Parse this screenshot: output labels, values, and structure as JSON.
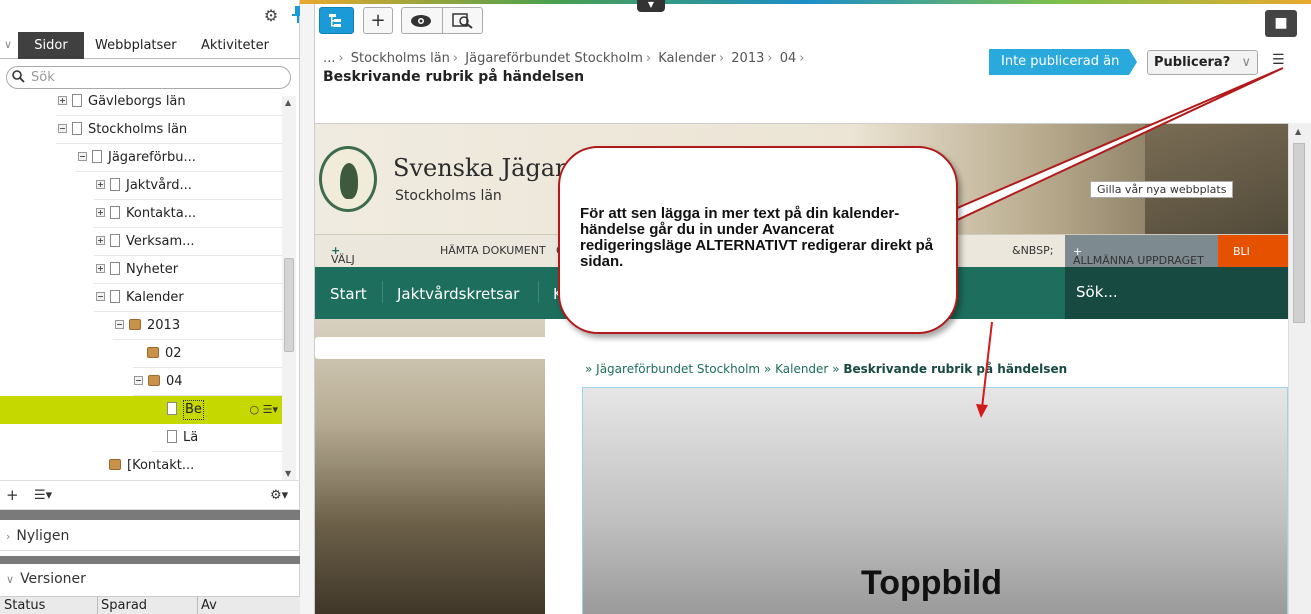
{
  "left_panel": {
    "tabs": [
      {
        "label": "Sidor",
        "active": true
      },
      {
        "label": "Webbplatser",
        "active": false
      },
      {
        "label": "Aktiviteter",
        "active": false
      }
    ],
    "search_placeholder": "Sök",
    "tree": [
      {
        "label": "Gävleborgs län"
      },
      {
        "label": "Stockholms län"
      },
      {
        "label": "Jägareförbu..."
      },
      {
        "label": "Jaktvård..."
      },
      {
        "label": "Kontakta..."
      },
      {
        "label": "Verksam..."
      },
      {
        "label": "Nyheter"
      },
      {
        "label": "Kalender"
      },
      {
        "label": "2013"
      },
      {
        "label": "02"
      },
      {
        "label": "04"
      },
      {
        "label": "Be"
      },
      {
        "label": "Lä"
      },
      {
        "label": "[Kontakt..."
      }
    ],
    "sections": {
      "recent": "Nyligen",
      "versions": "Versioner"
    },
    "versions_columns": [
      "Status",
      "Sparad",
      "Av"
    ]
  },
  "header": {
    "breadcrumb": [
      "...",
      "Stockholms län",
      "Jägareförbundet Stockholm",
      "Kalender",
      "2013",
      "04"
    ],
    "page_title": "Beskrivande rubrik på händelsen",
    "status": "Inte publicerad än",
    "publish_button": "Publicera?"
  },
  "site": {
    "name": "Svenska Jägaref",
    "subtitle": "Stockholms län",
    "like_tag": "Gilla vår nya webbplats",
    "topnav": {
      "items": [
        "VÄLJ DITT LÄN",
        "HÄMTA DOKUMENT",
        "C"
      ],
      "nbsp": "&NBSP;",
      "blue": "ALLMÄNNA UPPDRAGET",
      "orange": "BLI MEDLE"
    },
    "mainnav": {
      "items": [
        "Start",
        "Jaktvårdskretsar",
        "K"
      ],
      "search": "Sök..."
    },
    "content_breadcrumb": {
      "prefix1": "» ",
      "link1": "Jägareförbundet Stockholm",
      "prefix2": " » ",
      "link2": "Kalender",
      "prefix3": " » ",
      "current": "Beskrivande rubrik på händelsen"
    },
    "hero_label": "Toppbild"
  },
  "callout": {
    "text": "För att sen lägga in mer text på din kalender-händelse går du in under Avancerat redigeringsläge ALTERNATIVT redigerar direkt på sidan."
  },
  "colors": {
    "accent_blue": "#1a9ad6",
    "selection_green": "#c5d800",
    "site_green": "#1d6e5c",
    "callout_red": "#b21a1a"
  }
}
